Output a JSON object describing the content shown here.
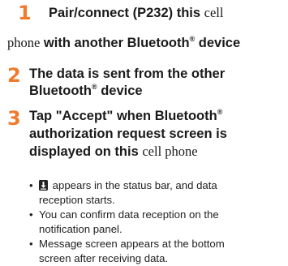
{
  "steps": [
    {
      "number": "1",
      "line1_a": "Pair/connect (P232) this ",
      "line1_b": "cell",
      "line2_a": "phone",
      "line2_b": " with another Bluetooth",
      "line2_sup": "®",
      "line2_c": " device"
    },
    {
      "number": "2",
      "line1": "The data is sent from the other",
      "line2_a": "Bluetooth",
      "line2_sup": "®",
      "line2_b": " device"
    },
    {
      "number": "3",
      "line1_a": "Tap \"Accept\" when Bluetooth",
      "line1_sup": "®",
      "line2": "authorization request screen is",
      "line3_a": "displayed on this ",
      "line3_b": "cell phone"
    }
  ],
  "bullets": [
    {
      "icon": "bluetooth-receive-icon",
      "line1": " appears in the status bar, and data",
      "line2": "reception starts."
    },
    {
      "line1": "You can confirm data reception on the",
      "line2": "notification panel."
    },
    {
      "line1": "Message screen appears at the bottom",
      "line2": "screen after receiving data."
    }
  ],
  "bullet_symbol": "•",
  "colors": {
    "step_number": "#f07a2c",
    "text": "#1a1a1a"
  }
}
